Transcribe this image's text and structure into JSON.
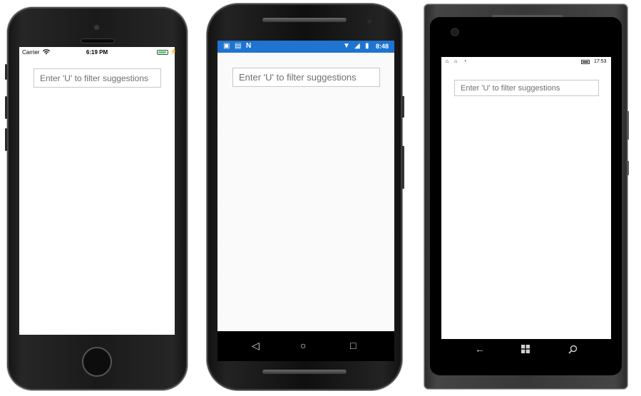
{
  "ios": {
    "status": {
      "carrier": "Carrier",
      "time": "6:19 PM"
    },
    "autocomplete": {
      "placeholder": "Enter 'U' to filter suggestions"
    }
  },
  "android": {
    "status": {
      "time": "8:48"
    },
    "autocomplete": {
      "placeholder": "Enter 'U' to filter suggestions"
    },
    "nav": {
      "back_icon": "back-triangle-icon",
      "home_icon": "home-circle-icon",
      "recents_icon": "recents-square-icon"
    }
  },
  "windows": {
    "status": {
      "time": "17:53"
    },
    "autocomplete": {
      "placeholder": "Enter 'U' to filter suggestions"
    },
    "nav": {
      "back_icon": "back-arrow-icon",
      "start_icon": "windows-logo-icon",
      "search_icon": "search-icon"
    }
  },
  "colors": {
    "android_status_bar": "#1e74d0",
    "ios_battery": "#4cd964",
    "input_border": "#c7c7c7"
  }
}
